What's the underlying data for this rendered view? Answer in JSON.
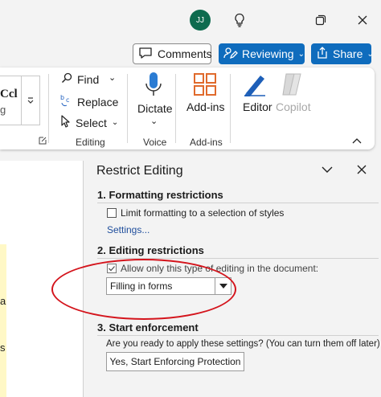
{
  "titlebar": {
    "avatar_initials": "JJ",
    "icons": [
      "lightbulb-icon",
      "restore-window-icon",
      "close-window-icon"
    ]
  },
  "top_buttons": {
    "comments": "Comments",
    "reviewing": "Reviewing",
    "share": "Share"
  },
  "ribbon": {
    "styles_preview": "Ccl",
    "styles_preview_sub": "g",
    "editing": {
      "find": "Find",
      "replace": "Replace",
      "select": "Select",
      "group_label": "Editing"
    },
    "voice": {
      "dictate": "Dictate",
      "group_label": "Voice"
    },
    "addins": {
      "addins": "Add-ins",
      "group_label": "Add-ins"
    },
    "editor": "Editor",
    "copilot": "Copilot"
  },
  "document": {
    "chars": [
      "a",
      "s"
    ]
  },
  "pane": {
    "title": "Restrict Editing",
    "section1": {
      "heading": "1. Formatting restrictions",
      "checkbox_label": "Limit formatting to a selection of styles",
      "settings_link": "Settings..."
    },
    "section2": {
      "heading": "2. Editing restrictions",
      "checkbox_label": "Allow only this type of editing in the document:",
      "select_value": "Filling in forms"
    },
    "section3": {
      "heading": "3. Start enforcement",
      "prompt": "Are you ready to apply these settings? (You can turn them off later)",
      "button": "Yes, Start Enforcing Protection"
    }
  },
  "colors": {
    "accent": "#0f6cbd",
    "annotation": "#d4141c",
    "avatar": "#0e6b4f"
  }
}
